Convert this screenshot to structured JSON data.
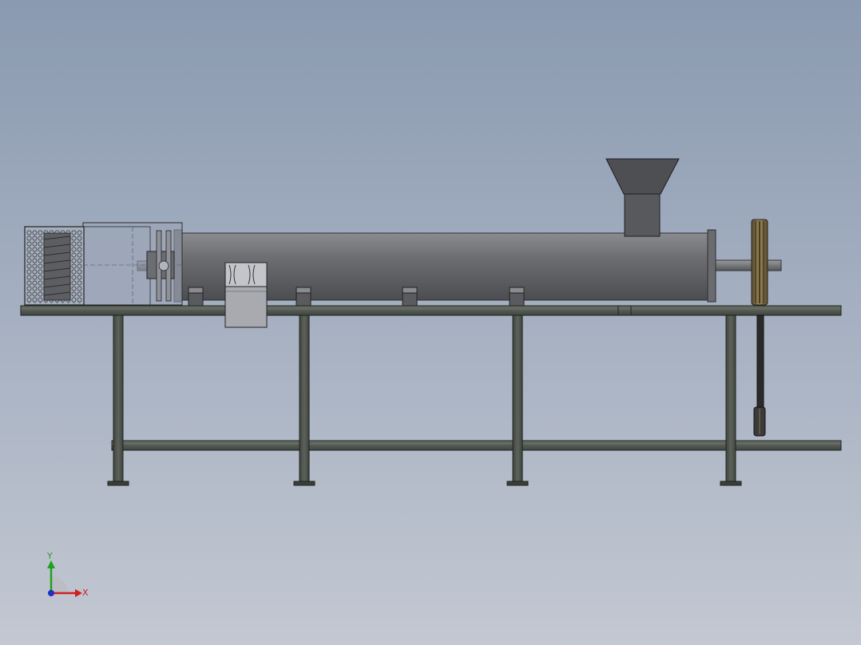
{
  "viewport": {
    "background_top": "#8a9ab0",
    "background_bottom": "#c3c8d2"
  },
  "model": {
    "view": "front",
    "parts": [
      "feed-hopper",
      "barrel",
      "screw-shaft",
      "drive-pulley",
      "drive-belt",
      "die-head",
      "die-guard",
      "cutter-box",
      "barrel-supports",
      "frame-top-rail",
      "frame-bottom-rail",
      "frame-legs"
    ],
    "colors": {
      "steel": "#5f6063",
      "frame": "#4a5048",
      "pulley": "#7a6a48",
      "belt": "#2a2a2a"
    }
  },
  "triad": {
    "x_label": "X",
    "y_label": "Y",
    "x_color": "#d02020",
    "y_color": "#20a020",
    "z_color": "#2030c0"
  }
}
